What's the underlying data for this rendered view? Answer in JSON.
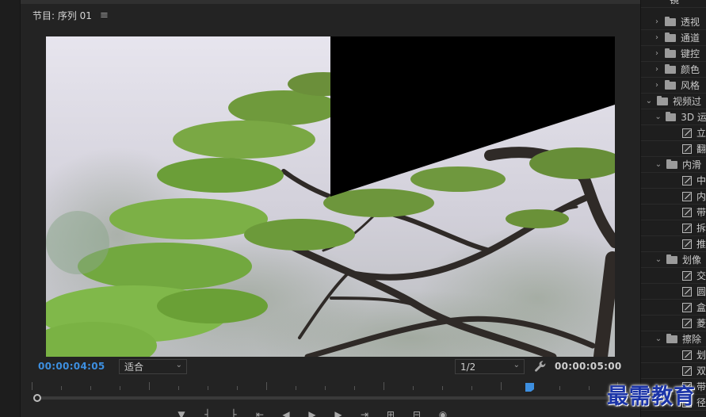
{
  "panel": {
    "title": "节目: 序列 01",
    "menu_icon": "hamburger-icon"
  },
  "viewer": {
    "content": "photo of pine tree in misty forest with black transition wedge"
  },
  "controls": {
    "current_timecode": "00:00:04:05",
    "fit_select": "适合",
    "resolution_select": "1/2",
    "duration_timecode": "00:00:05:00",
    "wrench_icon": "wrench-icon"
  },
  "transport": {
    "buttons": [
      "mark-in",
      "mark-out",
      "go-to-in",
      "step-back",
      "play",
      "step-forward",
      "go-to-out",
      "insert",
      "overwrite",
      "export-frame",
      "compare"
    ]
  },
  "effects_panel": {
    "rows": [
      {
        "type": "leaf",
        "label": "镜"
      },
      {
        "type": "folder",
        "label": "透视",
        "expanded": false
      },
      {
        "type": "folder",
        "label": "通道",
        "expanded": false
      },
      {
        "type": "folder",
        "label": "键控",
        "expanded": false
      },
      {
        "type": "folder",
        "label": "颜色",
        "expanded": false
      },
      {
        "type": "folder",
        "label": "风格",
        "expanded": false
      },
      {
        "type": "folder",
        "label": "视频过",
        "expanded": true
      },
      {
        "type": "folder",
        "label": "3D 运",
        "expanded": true
      },
      {
        "type": "leaf",
        "label": "立"
      },
      {
        "type": "leaf",
        "label": "翻"
      },
      {
        "type": "folder",
        "label": "内滑",
        "expanded": true
      },
      {
        "type": "leaf",
        "label": "中"
      },
      {
        "type": "leaf",
        "label": "内"
      },
      {
        "type": "leaf",
        "label": "带"
      },
      {
        "type": "leaf",
        "label": "拆"
      },
      {
        "type": "leaf",
        "label": "推"
      },
      {
        "type": "folder",
        "label": "划像",
        "expanded": true
      },
      {
        "type": "leaf",
        "label": "交"
      },
      {
        "type": "leaf",
        "label": "圆"
      },
      {
        "type": "leaf",
        "label": "盒"
      },
      {
        "type": "leaf",
        "label": "菱"
      },
      {
        "type": "folder",
        "label": "擦除",
        "expanded": true
      },
      {
        "type": "leaf",
        "label": "划"
      },
      {
        "type": "leaf",
        "label": "双"
      },
      {
        "type": "leaf",
        "label": "带"
      },
      {
        "type": "leaf",
        "label": "径"
      }
    ]
  },
  "watermark": {
    "text": "最需教育"
  },
  "colors": {
    "accent_timecode": "#3d8fe0",
    "panel_bg": "#232323",
    "watermark": "#1c35a8"
  }
}
